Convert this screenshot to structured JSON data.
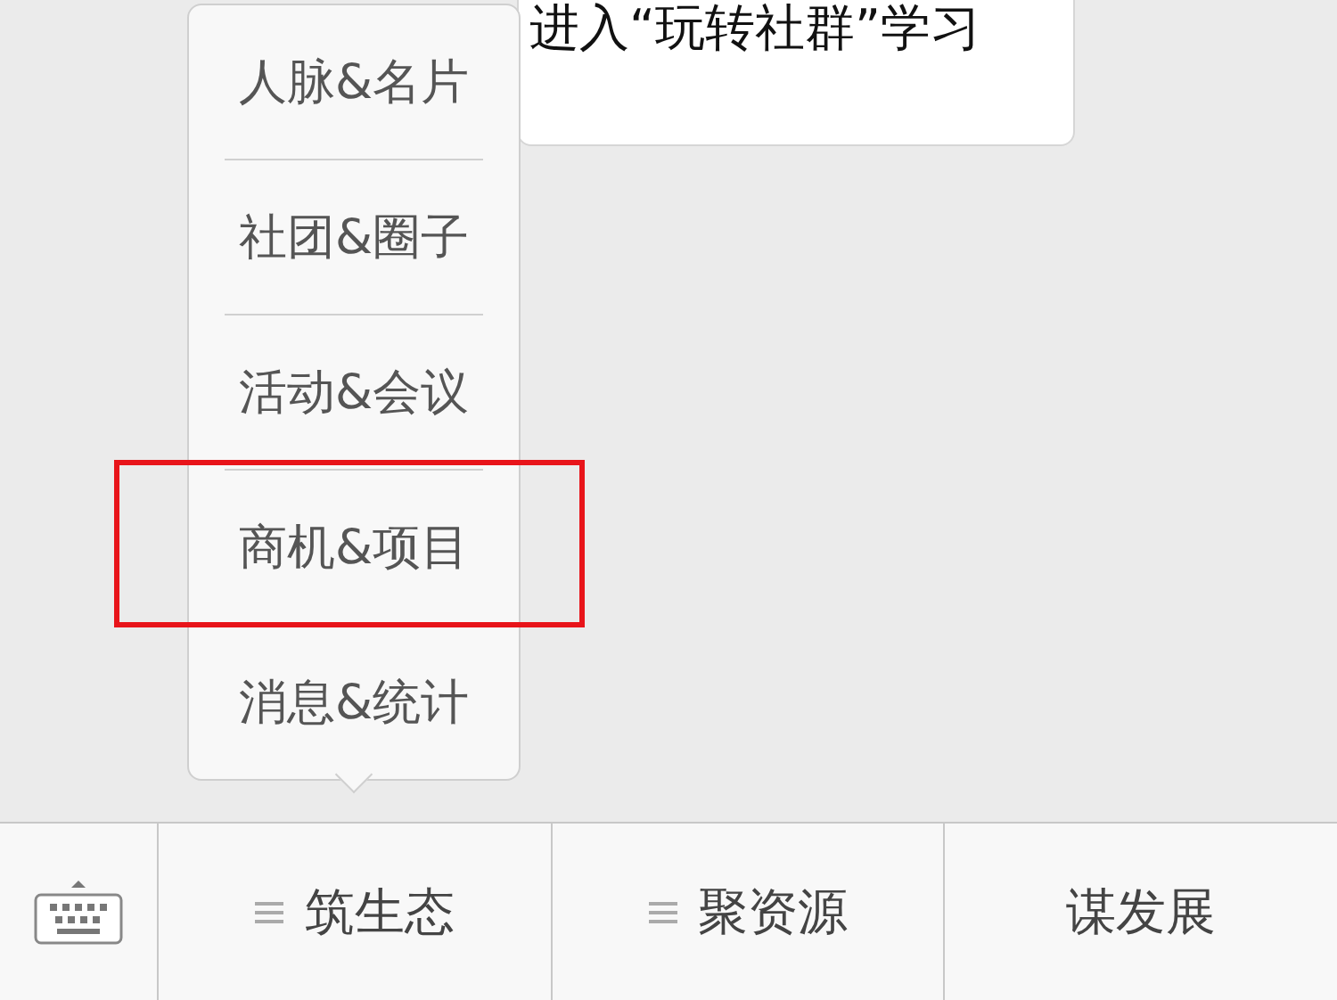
{
  "message": {
    "text": "进入“玩转社群”学习"
  },
  "popup_menu": {
    "items": [
      {
        "label": "人脉&名片",
        "highlighted": false
      },
      {
        "label": "社团&圈子",
        "highlighted": false
      },
      {
        "label": "活动&会议",
        "highlighted": false
      },
      {
        "label": "商机&项目",
        "highlighted": true
      },
      {
        "label": "消息&统计",
        "highlighted": false
      }
    ]
  },
  "bottom_bar": {
    "tabs": [
      {
        "label": "筑生态",
        "has_menu": true
      },
      {
        "label": "聚资源",
        "has_menu": true
      },
      {
        "label": "谋发展",
        "has_menu": false
      }
    ]
  }
}
